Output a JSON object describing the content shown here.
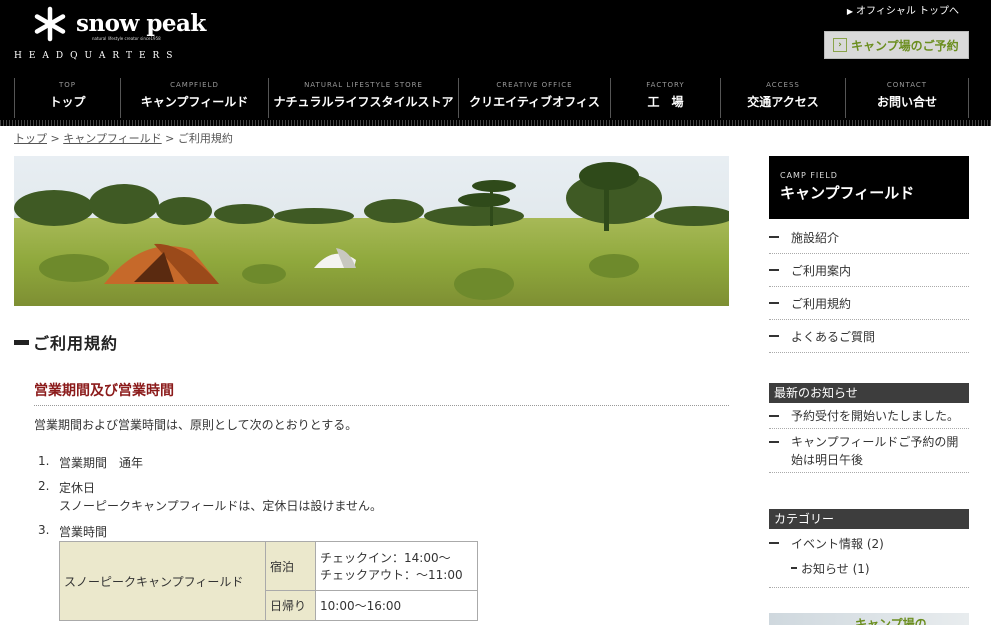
{
  "header": {
    "brand": "snow peak",
    "tagline": "natural lifestyle creator   since1958",
    "hq": "HEADQUARTERS",
    "official_link": "オフィシャル トップへ",
    "reserve_button": "キャンプ場のご予約"
  },
  "nav": {
    "items": [
      {
        "en": "TOP",
        "ja": "トップ"
      },
      {
        "en": "CAMPFIELD",
        "ja": "キャンプフィールド"
      },
      {
        "en": "NATURAL LIFESTYLE STORE",
        "ja": "ナチュラルライフスタイルストア"
      },
      {
        "en": "CREATIVE OFFICE",
        "ja": "クリエイティブオフィス"
      },
      {
        "en": "FACTORY",
        "ja": "工　場"
      },
      {
        "en": "ACCESS",
        "ja": "交通アクセス"
      },
      {
        "en": "CONTACT",
        "ja": "お問い合せ"
      }
    ]
  },
  "breadcrumb": {
    "home": "トップ",
    "sep": ">",
    "campfield": "キャンプフィールド",
    "current": "ご利用規約"
  },
  "main": {
    "title": "ご利用規約",
    "section_title": "営業期間及び営業時間",
    "intro": "営業期間および営業時間は、原則として次のとおりとする。",
    "rules": [
      {
        "num": "1.",
        "text": "営業期間　通年"
      },
      {
        "num": "2.",
        "text": "定休日",
        "detail": "スノーピークキャンプフィールドは、定休日は設けません。"
      },
      {
        "num": "3.",
        "text": "営業時間"
      }
    ],
    "hours_table": {
      "facility": "スノーピークキャンプフィールド",
      "stay_label": "宿泊",
      "checkin": "チェックイン：14:00〜",
      "checkout": "チェックアウト：〜11:00",
      "day_label": "日帰り",
      "day_hours": "10:00〜16:00"
    }
  },
  "sidebar": {
    "head_en": "CAMP FIELD",
    "head_ja": "キャンプフィールド",
    "menu": [
      {
        "label": "施設紹介"
      },
      {
        "label": "ご利用案内"
      },
      {
        "label": "ご利用規約"
      },
      {
        "label": "よくあるご質問"
      }
    ],
    "news_title": "最新のお知らせ",
    "news": [
      {
        "text": "予約受付を開始いたしました。"
      },
      {
        "text": "キャンプフィールドご予約の開始は明日午後"
      }
    ],
    "category_title": "カテゴリー",
    "categories": {
      "event": "イベント情報 (2)",
      "notice": "お知らせ (1)"
    },
    "banner_text": "キャンプ場の..."
  },
  "colors": {
    "header_bg": "#000000",
    "accent_green": "#6b8e1f",
    "section_red": "#8b1a1a",
    "table_bg": "#ebe8cc"
  }
}
